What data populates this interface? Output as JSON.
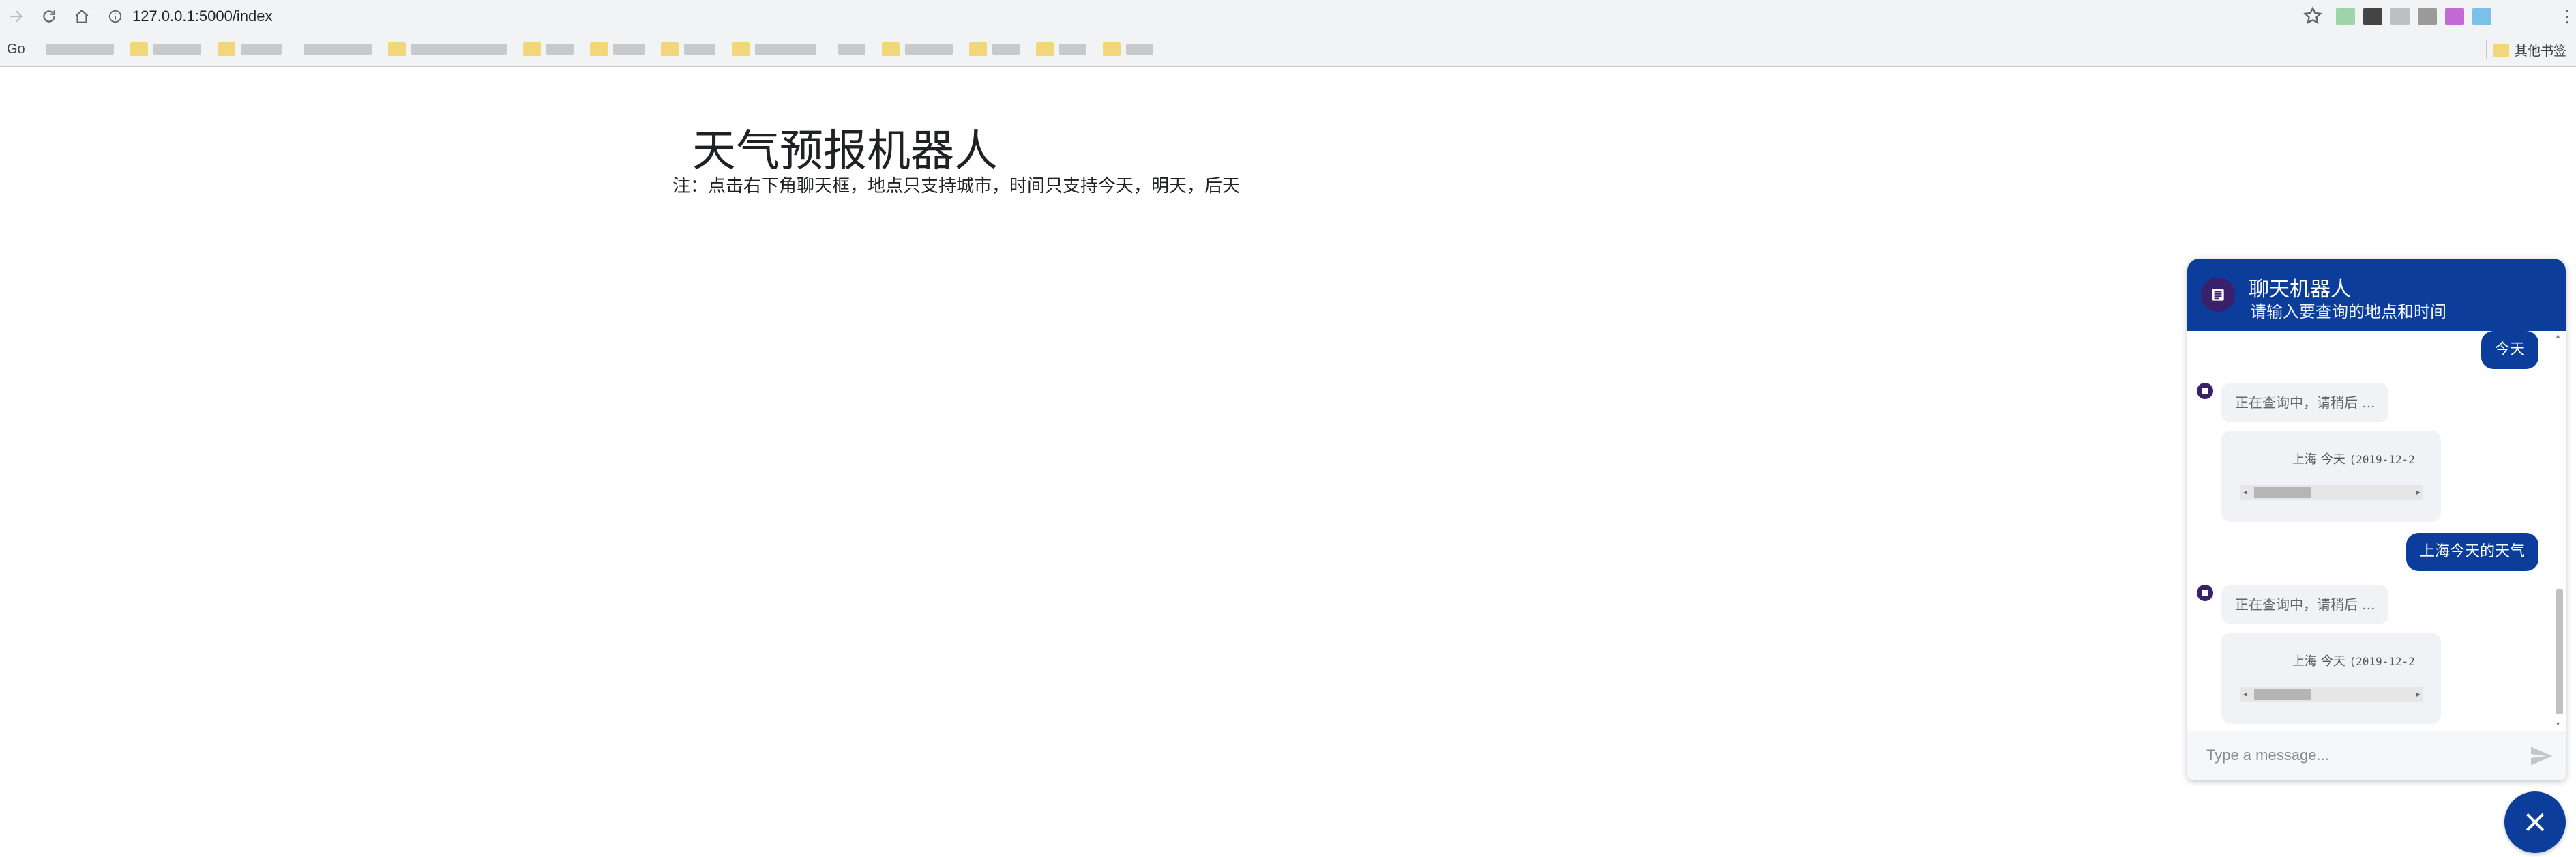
{
  "browser": {
    "url": "127.0.0.1:5000/index",
    "bookmarks_first": "Go",
    "other_bookmarks": "其他书签"
  },
  "page": {
    "title": "天气预报机器人",
    "note": "注：点击右下角聊天框，地点只支持城市，时间只支持今天，明天，后天"
  },
  "chat": {
    "title": "聊天机器人",
    "subtitle": "请输入要查询的地点和时间",
    "messages": [
      {
        "from": "user",
        "text": "今天"
      },
      {
        "from": "bot",
        "text": "正在查询中，请稍后 ..."
      },
      {
        "from": "bot_card",
        "text": "上海  今天",
        "date": "(2019-12-2"
      },
      {
        "from": "user",
        "text": "上海今天的天气"
      },
      {
        "from": "bot",
        "text": "正在查询中，请稍后 ..."
      },
      {
        "from": "bot_card",
        "text": "上海  今天",
        "date": "(2019-12-2"
      }
    ],
    "input_placeholder": "Type a message..."
  },
  "colors": {
    "primary": "#0c3d9a",
    "avatar": "#3a1f6b",
    "bot_bubble": "#f1f2f6"
  }
}
